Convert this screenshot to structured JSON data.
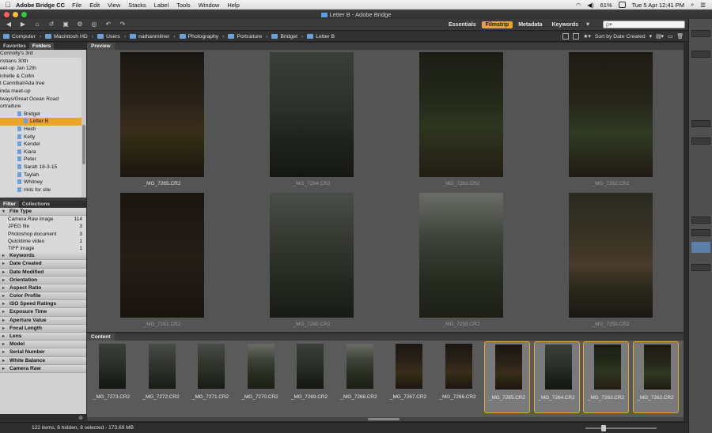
{
  "menubar": {
    "app": "Adobe Bridge CC",
    "items": [
      "File",
      "Edit",
      "View",
      "Stacks",
      "Label",
      "Tools",
      "Window",
      "Help"
    ],
    "battery": "61%",
    "clock": "Tue 5 Apr  12:41 PM"
  },
  "window": {
    "title": "Letter B - Adobe Bridge"
  },
  "toolbar": {
    "workspaces": [
      "Essentials",
      "Filmstrip",
      "Metadata",
      "Keywords"
    ],
    "active_workspace": "Filmstrip",
    "search_placeholder": "ρ▾"
  },
  "path": {
    "crumbs": [
      "Computer",
      "Macintosh HD",
      "Users",
      "nathanmilner",
      "Photography",
      "Portraiture",
      "Bridget",
      "Letter B"
    ],
    "sort_label": "Sort by Date Created"
  },
  "panels": {
    "left_tabs": [
      "Favorites",
      "Folders"
    ],
    "active_left_tab": "Folders",
    "filter_tabs": [
      "Filter",
      "Collections"
    ],
    "active_filter_tab": "Filter",
    "preview_label": "Preview",
    "content_label": "Content"
  },
  "folders": [
    {
      "label": "Connolly's 3rd",
      "sel": false
    },
    {
      "label": "ristians 30th",
      "sel": false
    },
    {
      "label": "eet-up Jan 12th",
      "sel": false
    },
    {
      "label": "ichelle & Collin",
      "sel": false
    },
    {
      "label": "t Cannibal/Ada tree",
      "sel": false
    },
    {
      "label": "inda meet-up",
      "sel": false
    },
    {
      "label": "tways/Great Ocean Road",
      "sel": false
    },
    {
      "label": "ortraiture",
      "sel": false
    },
    {
      "label": "Bridget",
      "sel": false
    },
    {
      "label": "Letter B",
      "sel": true
    },
    {
      "label": "Heidi",
      "sel": false
    },
    {
      "label": "Kelly",
      "sel": false
    },
    {
      "label": "Kendel",
      "sel": false
    },
    {
      "label": "Kiara",
      "sel": false
    },
    {
      "label": "Peter",
      "sel": false
    },
    {
      "label": "Sarah 18-3-15",
      "sel": false
    },
    {
      "label": "Taylah",
      "sel": false
    },
    {
      "label": "Whitney",
      "sel": false
    },
    {
      "label": "rints for site",
      "sel": false
    }
  ],
  "filter": {
    "file_type_header": "File Type",
    "file_types": [
      {
        "label": "Camera Raw image",
        "count": "114"
      },
      {
        "label": "JPEG file",
        "count": "3"
      },
      {
        "label": "Photoshop document",
        "count": "3"
      },
      {
        "label": "Quicktime video",
        "count": "1"
      },
      {
        "label": "TIFF image",
        "count": "1"
      }
    ],
    "sections": [
      "Keywords",
      "Date Created",
      "Date Modified",
      "Orientation",
      "Aspect Ratio",
      "Color Profile",
      "ISO Speed Ratings",
      "Exposure Time",
      "Aperture Value",
      "Focal Length",
      "Lens",
      "Model",
      "Serial Number",
      "White Balance",
      "Camera Raw"
    ]
  },
  "preview": [
    {
      "name": "_MG_7265.CR2",
      "tone": "moss1",
      "sel": true
    },
    {
      "name": "_MG_7264.CR2",
      "tone": "fog1",
      "sel": false
    },
    {
      "name": "_MG_7263.CR2",
      "tone": "leaf1",
      "sel": false
    },
    {
      "name": "_MG_7262.CR2",
      "tone": "leaf2",
      "sel": false
    },
    {
      "name": "_MG_7261.CR2",
      "tone": "dark1",
      "sel": false
    },
    {
      "name": "_MG_7260.CR2",
      "tone": "fog2",
      "sel": false
    },
    {
      "name": "_MG_7259.CR2",
      "tone": "fog3",
      "sel": false
    },
    {
      "name": "_MG_7258.CR2",
      "tone": "figure",
      "sel": false
    }
  ],
  "filmstrip": [
    {
      "name": "_MG_7273.CR2",
      "tone": "fog1",
      "sel": false
    },
    {
      "name": "_MG_7272.CR2",
      "tone": "fog2",
      "sel": false
    },
    {
      "name": "_MG_7271.CR2",
      "tone": "fog2",
      "sel": false
    },
    {
      "name": "_MG_7270.CR2",
      "tone": "fog3",
      "sel": false
    },
    {
      "name": "_MG_7269.CR2",
      "tone": "fog1",
      "sel": false
    },
    {
      "name": "_MG_7268.CR2",
      "tone": "fog3",
      "sel": false
    },
    {
      "name": "_MG_7267.CR2",
      "tone": "moss1",
      "sel": false
    },
    {
      "name": "_MG_7266.CR2",
      "tone": "moss1",
      "sel": false
    },
    {
      "name": "_MG_7265.CR2",
      "tone": "moss1",
      "sel": true
    },
    {
      "name": "_MG_7264.CR2",
      "tone": "fog1",
      "sel": true
    },
    {
      "name": "_MG_7263.CR2",
      "tone": "leaf1",
      "sel": true
    },
    {
      "name": "_MG_7262.CR2",
      "tone": "leaf2",
      "sel": true
    }
  ],
  "status": {
    "text": "122 items, 6 hidden, 8 selected - 173.69 MB"
  },
  "colors": {
    "accent": "#e8a52c",
    "panel": "#545454",
    "chrome": "#3a3a3a"
  }
}
